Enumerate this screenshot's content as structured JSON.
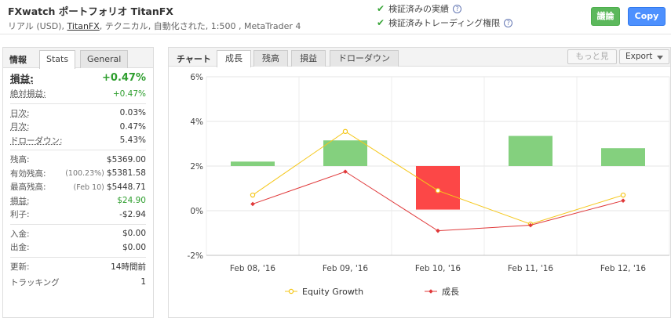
{
  "header": {
    "title": "FXwatch ポートフォリオ TitanFX",
    "subtitle_prefix": "リアル (USD), ",
    "broker": "TitanFX",
    "subtitle_suffix": ", テクニカル, 自動化された, 1:500 , MetaTrader 4",
    "verified_track_record": "検証済みの実績",
    "verified_trading_privileges": "検証済みトレーディング権限",
    "discuss_label": "議論",
    "copy_label": "Copy"
  },
  "left_panel": {
    "tab_label": "情報",
    "tabs": [
      "Stats",
      "General"
    ],
    "gain": {
      "label": "損益:",
      "value": "+0.47%"
    },
    "abs_gain": {
      "label": "絶対損益:",
      "value": "+0.47%"
    },
    "daily": {
      "label": "日次:",
      "value": "0.03%"
    },
    "monthly": {
      "label": "月次:",
      "value": "0.47%"
    },
    "drawdown": {
      "label": "ドローダウン:",
      "value": "5.43%"
    },
    "balance": {
      "label": "残高:",
      "value": "$5369.00"
    },
    "equity": {
      "label": "有効残高:",
      "note": "(100.23%)",
      "value": "$5381.58"
    },
    "highest": {
      "label": "最高残高:",
      "note": "(Feb 10)",
      "value": "$5448.71"
    },
    "profit": {
      "label": "損益:",
      "value": "$24.90"
    },
    "interest": {
      "label": "利子:",
      "value": "-$2.94"
    },
    "deposits": {
      "label": "入金:",
      "value": "$0.00"
    },
    "withdrawals": {
      "label": "出金:",
      "value": "$0.00"
    },
    "updated": {
      "label": "更新:",
      "value": "14時間前"
    },
    "tracking": {
      "label": "トラッキング",
      "value": "1"
    }
  },
  "right_panel": {
    "tab_label": "チャート",
    "tabs": [
      "成長",
      "残高",
      "損益",
      "ドローダウン"
    ],
    "more_label": "もっと見",
    "export_label": "Export"
  },
  "colors": {
    "bar_positive": "#84d07e",
    "bar_negative": "#fc4747",
    "equity_line": "#f5c71a",
    "growth_line": "#e0393a",
    "green_text": "#2e9e2e",
    "copy_button": "#4d90fe",
    "discuss_button": "#5cb85c"
  },
  "chart_data": {
    "type": "bar+line",
    "categories": [
      "Feb 08, '16",
      "Feb 09, '16",
      "Feb 10, '16",
      "Feb 11, '16",
      "Feb 12, '16"
    ],
    "yticks": [
      "6%",
      "4%",
      "2%",
      "0%",
      "-2%"
    ],
    "ylim": [
      -2,
      6
    ],
    "bars": [
      {
        "from": 2.0,
        "to": 2.2
      },
      {
        "from": 2.0,
        "to": 3.15
      },
      {
        "from": 2.0,
        "to": 0.05
      },
      {
        "from": 2.0,
        "to": 3.35
      },
      {
        "from": 2.0,
        "to": 2.8
      }
    ],
    "series": [
      {
        "name": "Equity Growth",
        "values": [
          0.7,
          3.55,
          0.9,
          -0.6,
          0.7
        ]
      },
      {
        "name": "成長",
        "values": [
          0.3,
          1.75,
          -0.9,
          -0.65,
          0.45
        ]
      }
    ],
    "legend_position": "bottom"
  }
}
